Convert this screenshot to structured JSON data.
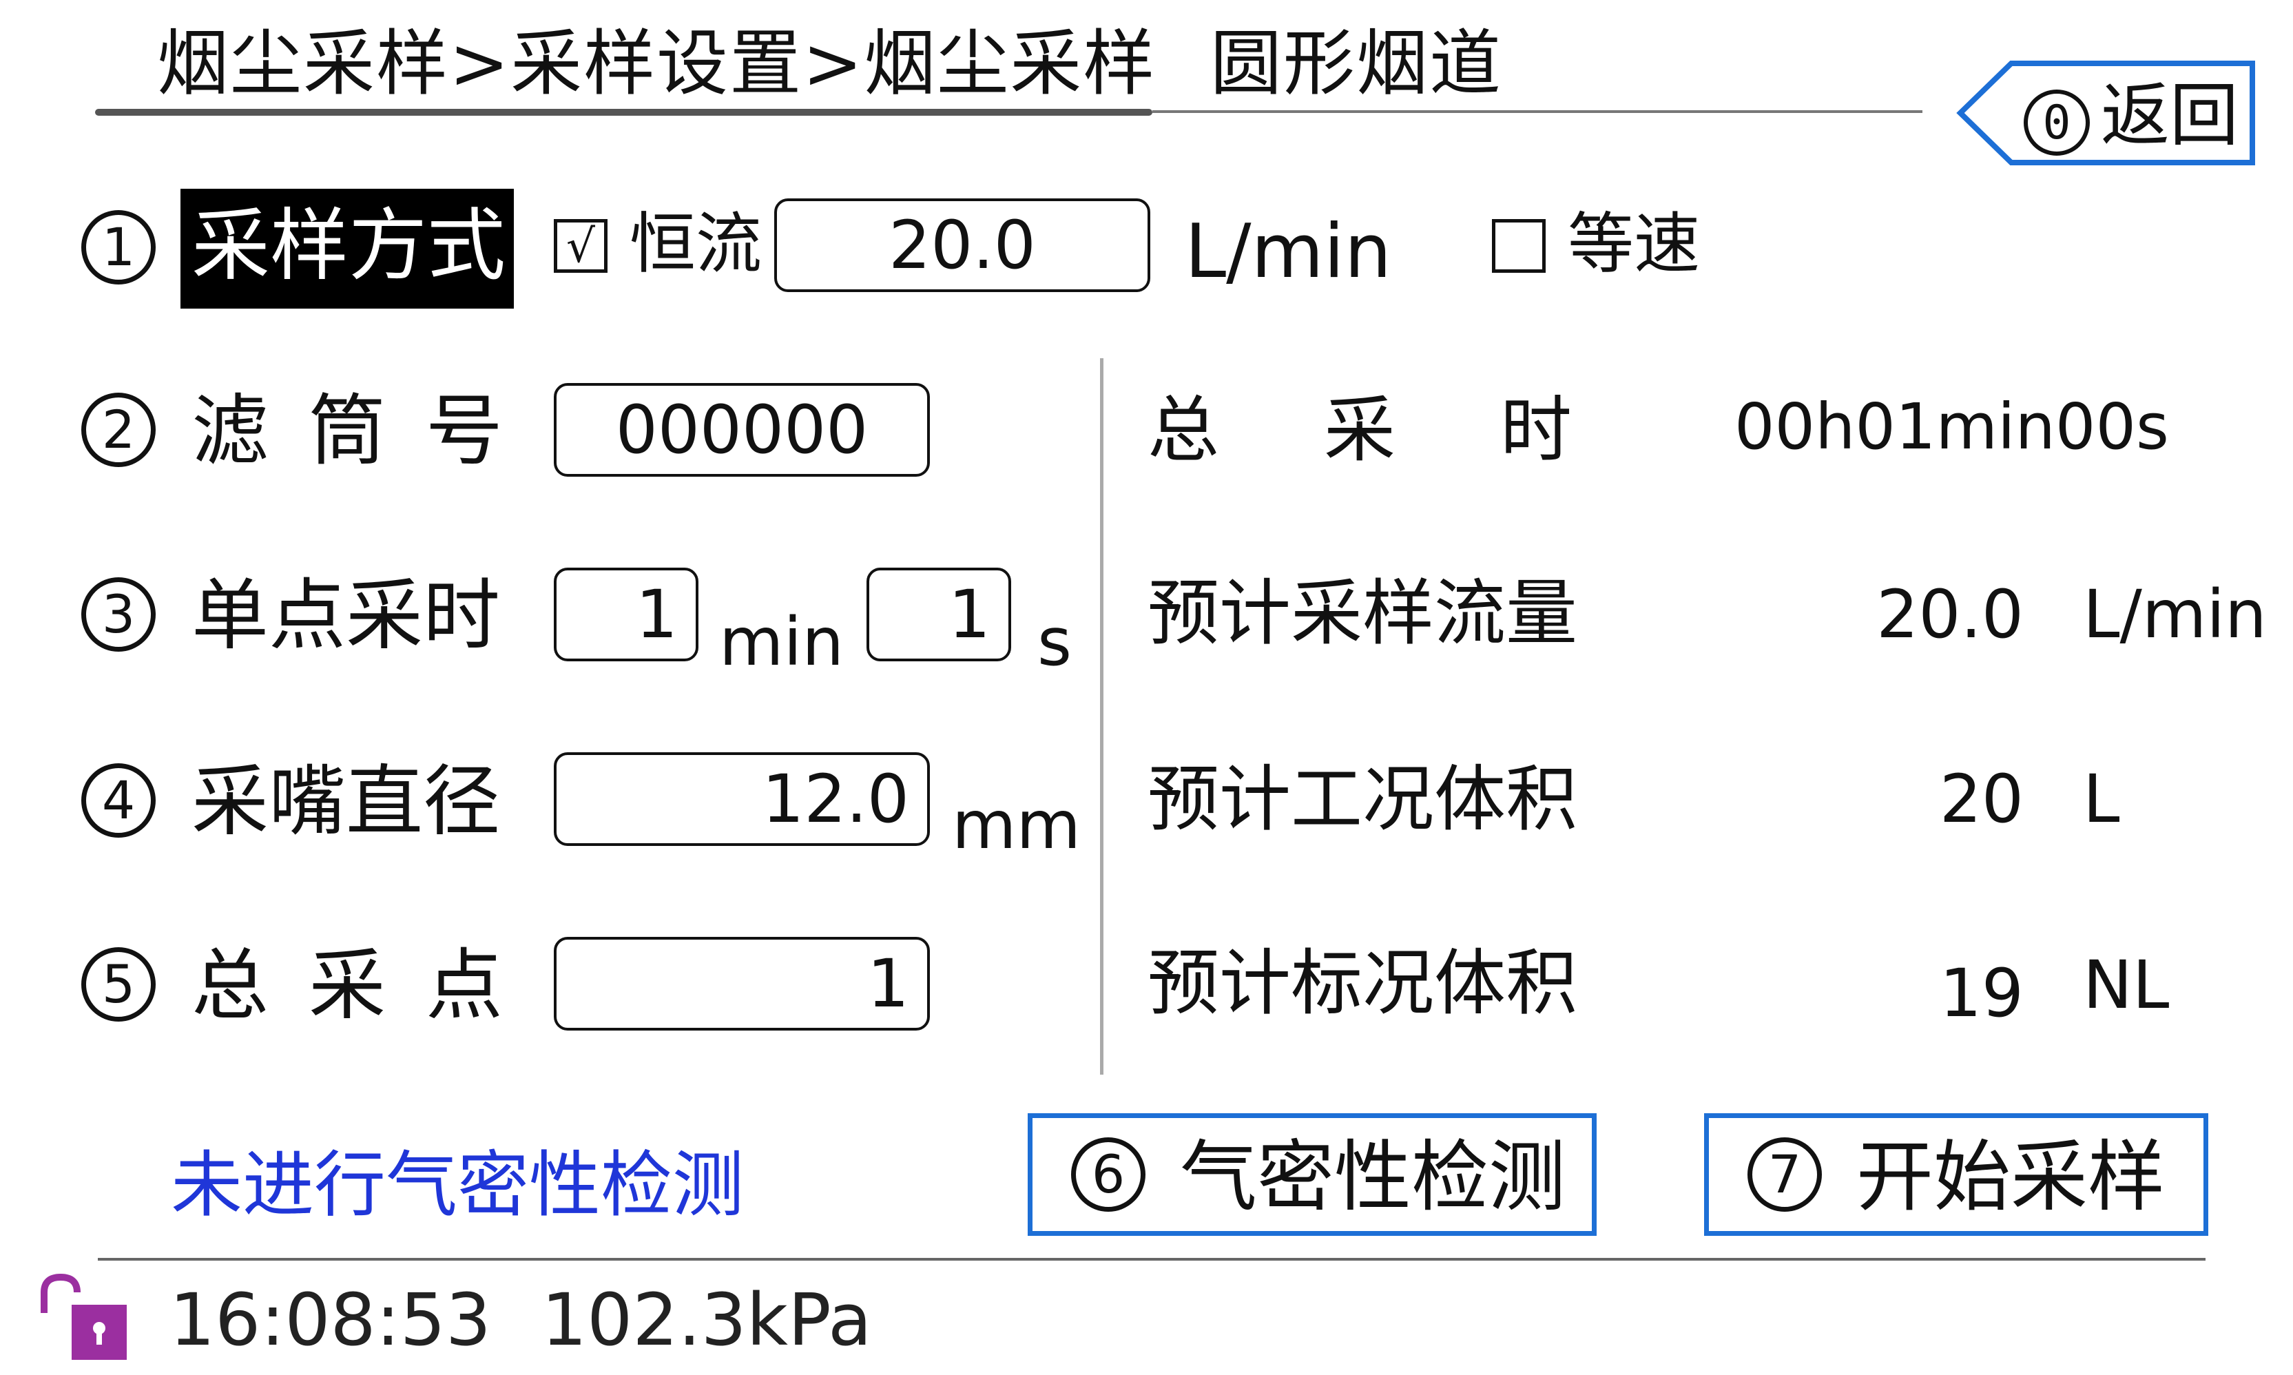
{
  "header": {
    "breadcrumb": "烟尘采样>采样设置>烟尘采样",
    "title": "圆形烟道",
    "back_number": "0",
    "back_label": "返回"
  },
  "rows": {
    "mode": {
      "number": "1",
      "label": "采样方式",
      "constant_flow_check": "√",
      "constant_flow_label": "恒流",
      "flow_value": "20.0",
      "flow_unit": "L/min",
      "isokinetic_check": "",
      "isokinetic_label": "等速"
    },
    "filter": {
      "number": "2",
      "label": "滤筒号",
      "value": "000000"
    },
    "point_time": {
      "number": "3",
      "label": "单点采时",
      "min_value": "1",
      "min_unit": "min",
      "sec_value": "1",
      "sec_unit": "s"
    },
    "nozzle": {
      "number": "4",
      "label": "采嘴直径",
      "value": "12.0",
      "unit": "mm"
    },
    "points": {
      "number": "5",
      "label": "总采点",
      "value": "1"
    }
  },
  "summary": {
    "total_time_label": "总采时",
    "total_time_value": "00h01min00s",
    "flow_label": "预计采样流量",
    "flow_value": "20.0",
    "flow_unit": "L/min",
    "work_volume_label": "预计工况体积",
    "work_volume_value": "20",
    "work_volume_unit": "L",
    "std_volume_label": "预计标况体积",
    "std_volume_value": "19",
    "std_volume_unit": "NL"
  },
  "actions": {
    "leak_test_number": "6",
    "leak_test_label": "气密性检测",
    "start_number": "7",
    "start_label": "开始采样"
  },
  "status": {
    "leak_status": "未进行气密性检测",
    "lock_icon": "unlocked-padlock-icon",
    "time": "16:08:53",
    "pressure": "102.3kPa"
  },
  "colors": {
    "accent_blue": "#1d6fd6",
    "status_blue": "#1f36d8",
    "lock_purple": "#9b2fa0"
  }
}
